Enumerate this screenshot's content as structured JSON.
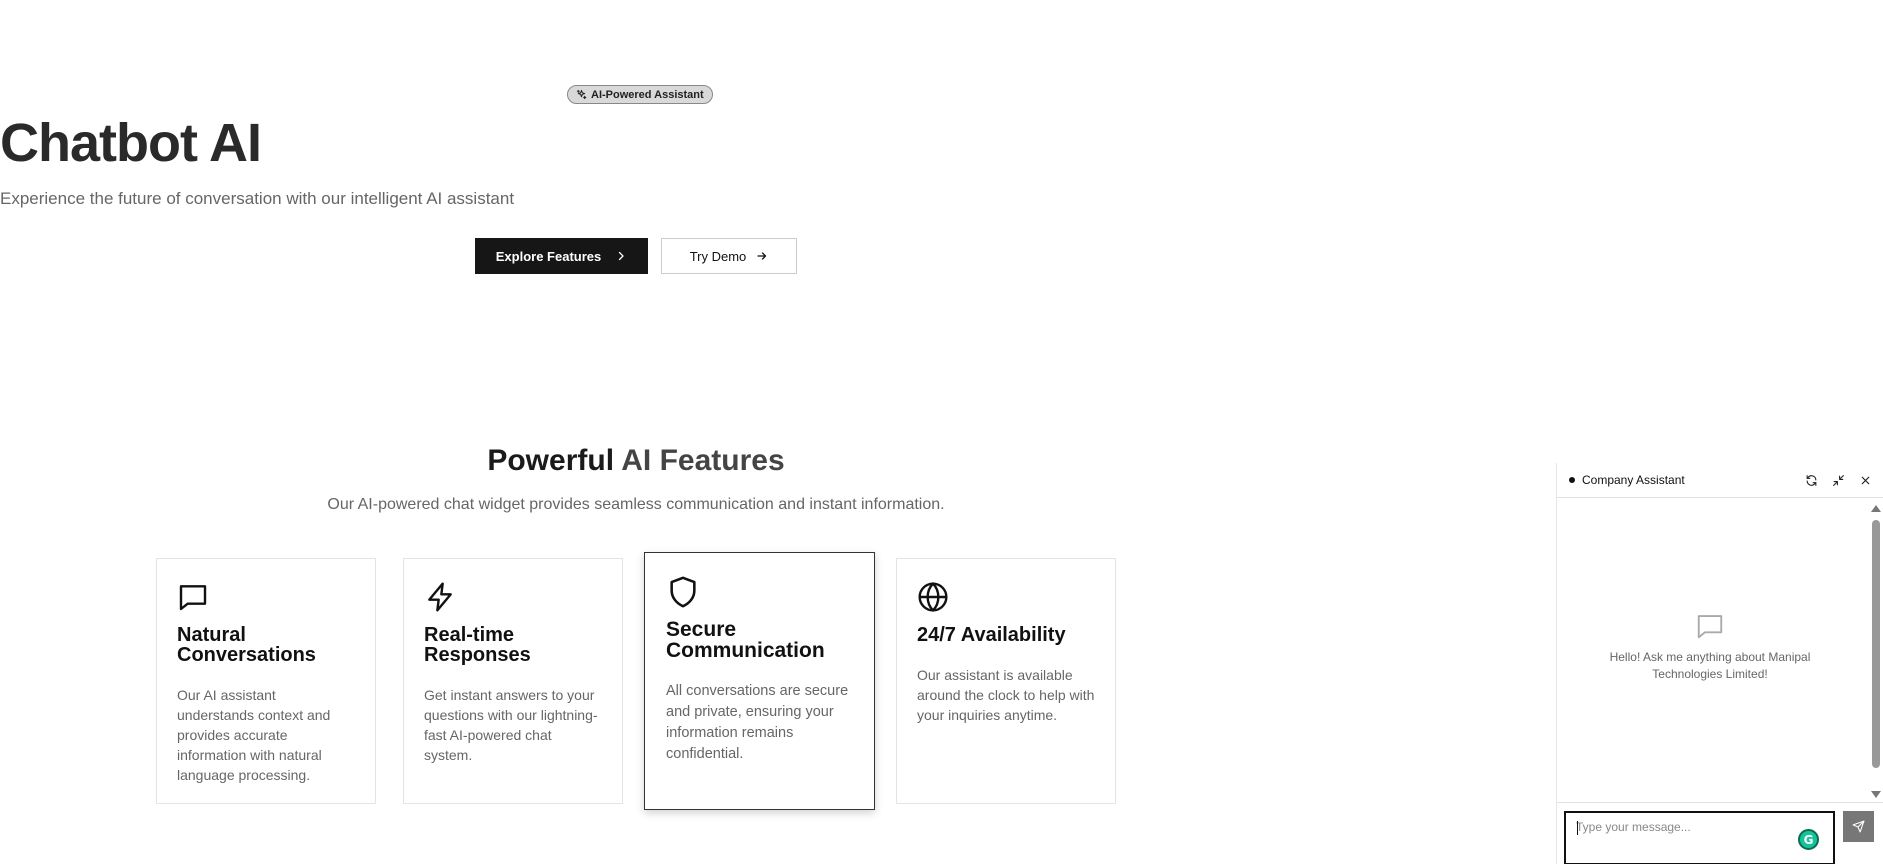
{
  "hero": {
    "badge": "AI-Powered Assistant",
    "title": "Chatbot AI",
    "subtitle": "Experience the future of conversation with our intelligent AI assistant",
    "primary_button": "Explore Features",
    "secondary_button": "Try Demo"
  },
  "features": {
    "title_bold": "Powerful ",
    "title_light": "AI Features",
    "subtitle": "Our AI-powered chat widget provides seamless communication and instant information.",
    "cards": [
      {
        "icon": "message-square-icon",
        "title": "Natural Conversations",
        "text": "Our AI assistant understands context and provides accurate information with natural language processing."
      },
      {
        "icon": "zap-icon",
        "title": "Real-time Responses",
        "text": "Get instant answers to your questions with our lightning-fast AI-powered chat system."
      },
      {
        "icon": "shield-icon",
        "title": "Secure Communication",
        "text": "All conversations are secure and private, ensuring your information remains confidential."
      },
      {
        "icon": "globe-icon",
        "title": "24/7 Availability",
        "text": "Our assistant is available around the clock to help with your inquiries anytime."
      }
    ]
  },
  "chat": {
    "title": "Company Assistant",
    "empty_message": "Hello! Ask me anything about Manipal Technologies Limited!",
    "input_placeholder": "Type your message...",
    "header_icons": [
      "refresh-icon",
      "minimize-icon",
      "close-icon"
    ],
    "send_icon": "send-icon"
  },
  "colors": {
    "primary": "#161616",
    "badge_bg": "#d9d9d9",
    "send_bg": "#777777",
    "grammarly": "#15c39a"
  }
}
